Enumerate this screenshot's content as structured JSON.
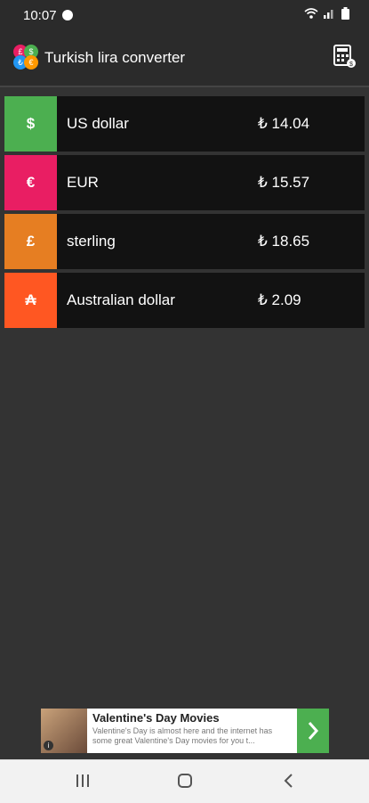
{
  "status": {
    "time": "10:07"
  },
  "app": {
    "title": "Turkish lira converter"
  },
  "currencies": [
    {
      "symbol": "$",
      "name": "US dollar",
      "value": "₺ 14.04",
      "color": "#4caf50"
    },
    {
      "symbol": "€",
      "name": "EUR",
      "value": "₺ 15.57",
      "color": "#e91e63"
    },
    {
      "symbol": "£",
      "name": "sterling",
      "value": "₺ 18.65",
      "color": "#e67e22"
    },
    {
      "symbol": "₳",
      "name": "Australian dollar",
      "value": "₺ 2.09",
      "color": "#ff5722"
    }
  ],
  "ad": {
    "title": "Valentine's Day Movies",
    "body": "Valentine's Day is almost here and the internet has some great Valentine's Day movies for you t..."
  }
}
